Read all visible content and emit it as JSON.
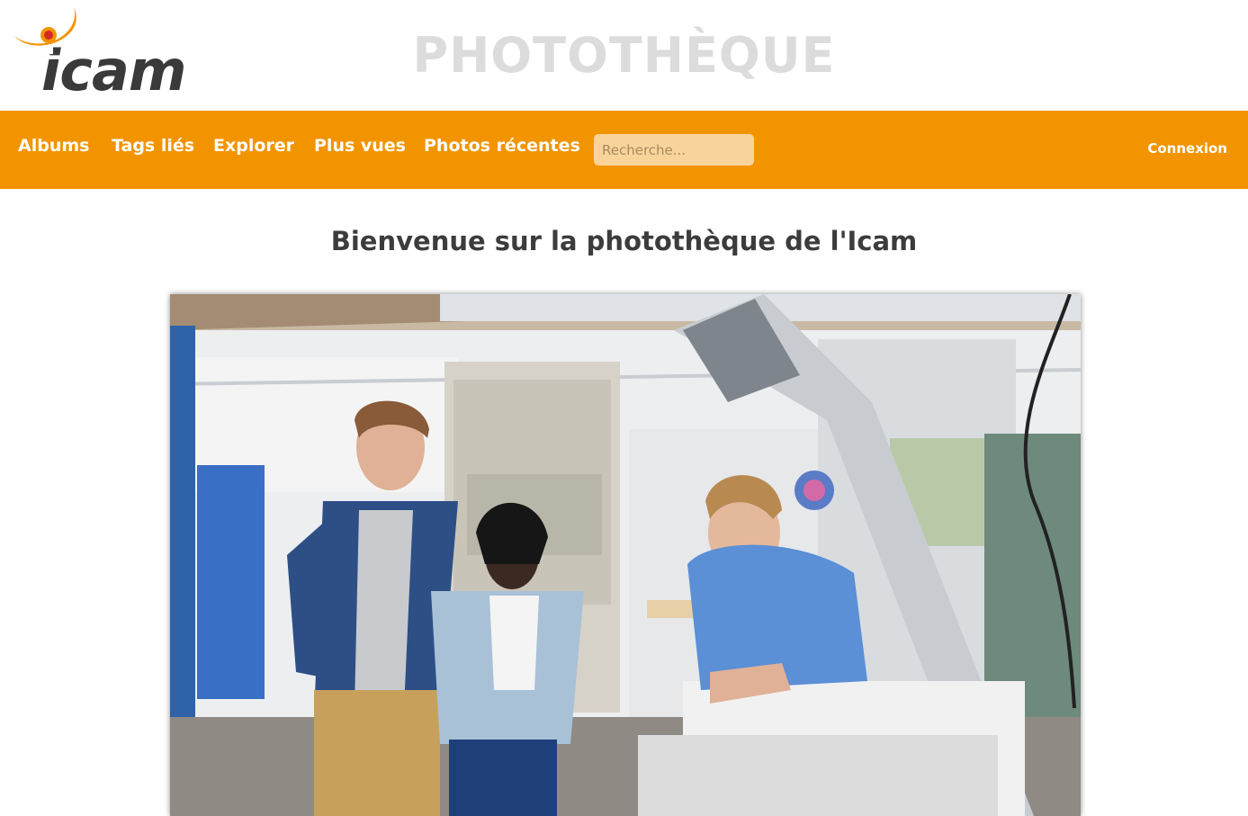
{
  "header": {
    "logo_alt": "icam",
    "site_title": "PHOTOTHÈQUE"
  },
  "nav": {
    "items": [
      {
        "label": "Albums"
      },
      {
        "label": "Tags liés"
      },
      {
        "label": "Explorer"
      },
      {
        "label": "Plus vues"
      },
      {
        "label": "Photos récentes"
      }
    ],
    "search_placeholder": "Recherche...",
    "login_label": "Connexion"
  },
  "main": {
    "welcome_title": "Bienvenue sur la photothèque de l'Icam"
  },
  "colors": {
    "brand_orange": "#f29400",
    "logo_text": "#3a3a3a",
    "logo_red": "#d62828"
  },
  "icons": {
    "logo": "icam-logo"
  }
}
